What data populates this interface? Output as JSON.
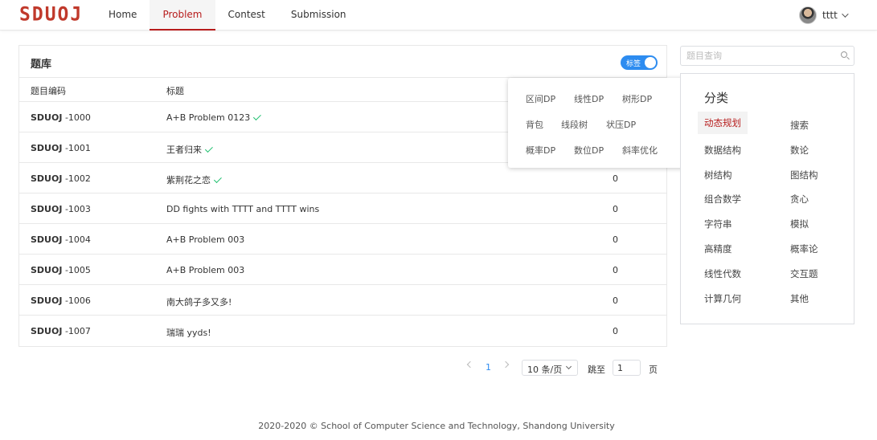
{
  "header": {
    "logo": "SDUOJ",
    "nav": [
      {
        "label": "Home",
        "active": false
      },
      {
        "label": "Problem",
        "active": true
      },
      {
        "label": "Contest",
        "active": false
      },
      {
        "label": "Submission",
        "active": false
      }
    ],
    "user": {
      "name": "tttt"
    }
  },
  "problem_card": {
    "title": "题库",
    "toggle": {
      "label": "标签",
      "on": true
    },
    "columns": {
      "id": "题目编码",
      "title": "标题"
    },
    "rows": [
      {
        "prefix": "SDUOJ",
        "id": "-1000",
        "title": "A+B Problem 0123",
        "solved": true,
        "count": ""
      },
      {
        "prefix": "SDUOJ",
        "id": "-1001",
        "title": "王者归来",
        "solved": true,
        "count": ""
      },
      {
        "prefix": "SDUOJ",
        "id": "-1002",
        "title": "紫荆花之恋",
        "solved": true,
        "count": "0"
      },
      {
        "prefix": "SDUOJ",
        "id": "-1003",
        "title": "DD fights with TTTT and TTTT wins",
        "solved": false,
        "count": "0"
      },
      {
        "prefix": "SDUOJ",
        "id": "-1004",
        "title": "A+B Problem 003",
        "solved": false,
        "count": "0"
      },
      {
        "prefix": "SDUOJ",
        "id": "-1005",
        "title": "A+B Problem 003",
        "solved": false,
        "count": "0"
      },
      {
        "prefix": "SDUOJ",
        "id": "-1006",
        "title": "南大鸽子多又多!",
        "solved": false,
        "count": "0"
      },
      {
        "prefix": "SDUOJ",
        "id": "-1007",
        "title": "瑞瑞 yyds!",
        "solved": false,
        "count": "0"
      }
    ]
  },
  "popover": {
    "tags": [
      "区间DP",
      "线性DP",
      "树形DP",
      "背包",
      "线段树",
      "状压DP",
      "概率DP",
      "数位DP",
      "斜率优化"
    ]
  },
  "search": {
    "placeholder": "题目查询",
    "value": ""
  },
  "categories": {
    "title": "分类",
    "items": [
      "动态规划",
      "搜索",
      "数据结构",
      "数论",
      "树结构",
      "图结构",
      "组合数学",
      "贪心",
      "字符串",
      "模拟",
      "高精度",
      "概率论",
      "线性代数",
      "交互题",
      "计算几何",
      "其他"
    ],
    "active": "动态规划"
  },
  "pagination": {
    "current": "1",
    "page_size": "10 条/页",
    "jump_label": "跳至",
    "jump_value": "1",
    "page_label": "页"
  },
  "footer": {
    "text": "2020-2020 © School of Computer Science and Technology, Shandong University"
  },
  "colors": {
    "accent": "#b71c1c",
    "primary": "#2d8cf0",
    "success": "#19be6b"
  }
}
